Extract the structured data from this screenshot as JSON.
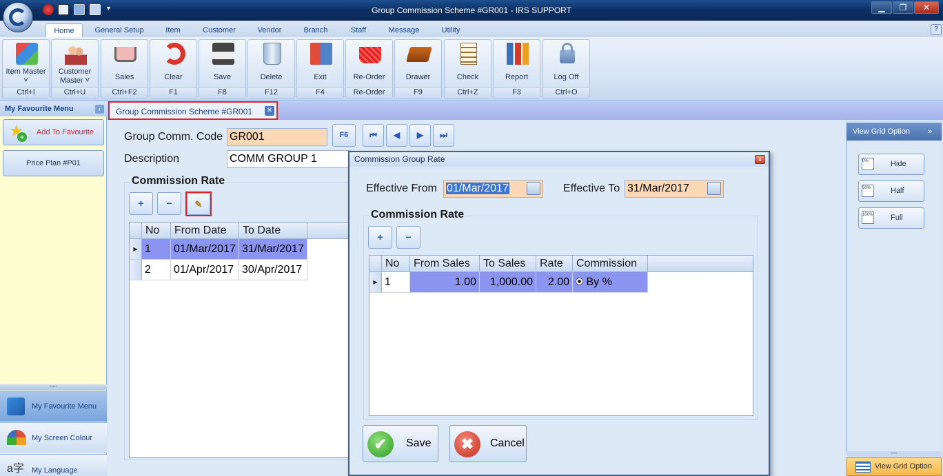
{
  "window": {
    "title": "Group Commission Scheme #GR001 - IRS SUPPORT",
    "controls": {
      "minimize": "▁",
      "maximize": "❐",
      "close": "✕"
    },
    "help": "?"
  },
  "ribbon_tabs": [
    "Home",
    "General Setup",
    "Item",
    "Customer",
    "Vendor",
    "Branch",
    "Staff",
    "Message",
    "Utility"
  ],
  "ribbon_buttons": [
    {
      "label": "Item Master ˅",
      "shortcut": "Ctrl+I",
      "icon": "item-master-icon"
    },
    {
      "label": "Customer Master ˅",
      "shortcut": "Ctrl+U",
      "icon": "customer-master-icon"
    },
    {
      "label": "Sales",
      "shortcut": "Ctrl+F2",
      "icon": "cart-icon"
    },
    {
      "label": "Clear",
      "shortcut": "F1",
      "icon": "clear-icon"
    },
    {
      "label": "Save",
      "shortcut": "F8",
      "icon": "floppy-icon"
    },
    {
      "label": "Delete",
      "shortcut": "F12",
      "icon": "trash-icon"
    },
    {
      "label": "Exit",
      "shortcut": "F4",
      "icon": "exit-door-icon"
    },
    {
      "label": "Re-Order",
      "shortcut": "Re-Order",
      "icon": "basket-icon"
    },
    {
      "label": "Drawer",
      "shortcut": "F9",
      "icon": "drawer-icon"
    },
    {
      "label": "Check",
      "shortcut": "Ctrl+Z",
      "icon": "checklist-icon"
    },
    {
      "label": "Report",
      "shortcut": "F3",
      "icon": "report-chart-icon"
    },
    {
      "label": "Log Off",
      "shortcut": "Ctrl+O",
      "icon": "lock-icon"
    }
  ],
  "left_panel": {
    "header": "My Favourite Menu",
    "add_favourite": "Add To Favourite",
    "items": [
      "Price Plan #P01"
    ],
    "nav": [
      "My Favourite Menu",
      "My Screen Colour",
      "My Language"
    ]
  },
  "doc_tab": {
    "label": "Group Commission Scheme #GR001",
    "close": "✕"
  },
  "form": {
    "code_label": "Group Comm. Code",
    "code_value": "GR001",
    "lookup_button": "F6",
    "description_label": "Description",
    "description_value": "COMM GROUP 1",
    "nav_buttons": [
      "⏮",
      "◀",
      "▶",
      "⏭"
    ],
    "section_title": "Commission Rate",
    "add_btn": "+",
    "remove_btn": "−",
    "grid": {
      "headers": [
        "No",
        "From Date",
        "To Date"
      ],
      "rows": [
        {
          "no": "1",
          "from": "01/Mar/2017",
          "to": "31/Mar/2017",
          "selected": true
        },
        {
          "no": "2",
          "from": "01/Apr/2017",
          "to": "30/Apr/2017",
          "selected": false
        }
      ]
    }
  },
  "right_panel": {
    "header": "View Grid Option",
    "collapse": "»",
    "options": [
      {
        "label": "Hide",
        "badge": "0%"
      },
      {
        "label": "Half",
        "badge": "50%"
      },
      {
        "label": "Full",
        "badge": "100%"
      }
    ],
    "footer": "View Grid Option"
  },
  "dialog": {
    "title": "Commission Group Rate",
    "close": "x",
    "effective_from_label": "Effective From",
    "effective_from_value": "01/Mar/2017",
    "effective_to_label": "Effective To",
    "effective_to_value": "31/Mar/2017",
    "section_title": "Commission Rate",
    "add_btn": "+",
    "remove_btn": "−",
    "grid": {
      "headers": [
        "No",
        "From Sales",
        "To Sales",
        "Rate",
        "Commission"
      ],
      "rows": [
        {
          "no": "1",
          "from_sales": "1.00",
          "to_sales": "1,000.00",
          "rate": "2.00",
          "commission": "By %"
        }
      ]
    },
    "save": "Save",
    "cancel": "Cancel"
  },
  "colors": {
    "accent": "#15428b",
    "selection": "#8b94f0",
    "highlight_field": "#fbd9b6",
    "red_outline": "#e0202a"
  }
}
